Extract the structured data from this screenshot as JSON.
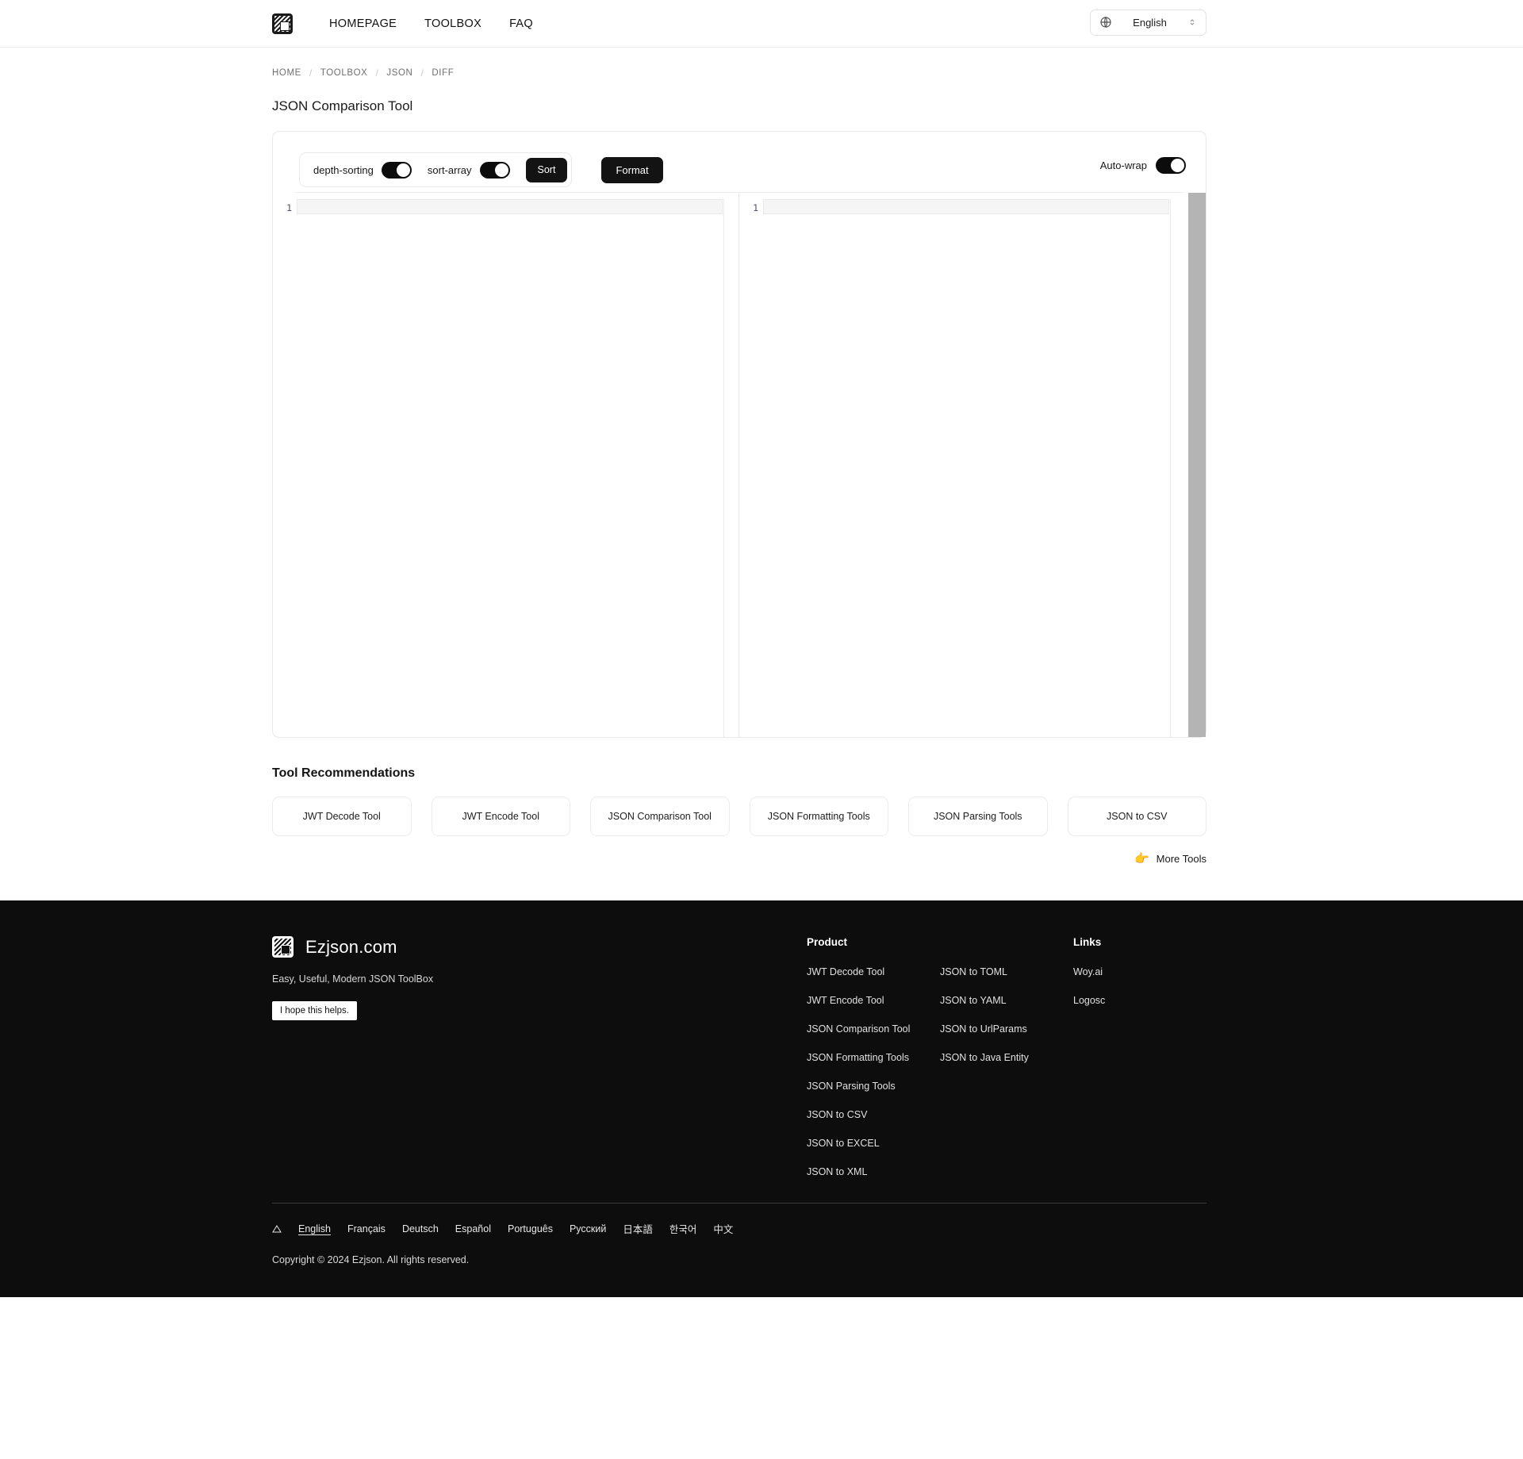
{
  "header": {
    "logo_alt": "Ezjson logo",
    "nav": [
      {
        "label": "HOMEPAGE"
      },
      {
        "label": "TOOLBOX"
      },
      {
        "label": "FAQ"
      }
    ],
    "language_selector": {
      "value": "English",
      "icon": "globe-icon",
      "chevron": "chevron-up-down-icon"
    }
  },
  "breadcrumb": {
    "items": [
      {
        "label": "HOME"
      },
      {
        "label": "TOOLBOX"
      },
      {
        "label": "JSON"
      },
      {
        "label": "DIFF"
      }
    ],
    "separator": "/"
  },
  "page": {
    "title": "JSON Comparison Tool"
  },
  "toolbar": {
    "depth_sorting_label": "depth-sorting",
    "depth_sorting_on": true,
    "sort_array_label": "sort-array",
    "sort_array_on": true,
    "sort_button": "Sort",
    "format_button": "Format",
    "auto_wrap_label": "Auto-wrap",
    "auto_wrap_on": true
  },
  "editor": {
    "left": {
      "line_numbers": [
        "1"
      ],
      "content": ""
    },
    "right": {
      "line_numbers": [
        "1"
      ],
      "content": ""
    },
    "scrollbar_color": "#b4b4b4"
  },
  "recommendations": {
    "title": "Tool Recommendations",
    "cards": [
      {
        "label": "JWT Decode Tool"
      },
      {
        "label": "JWT Encode Tool"
      },
      {
        "label": "JSON Comparison Tool"
      },
      {
        "label": "JSON Formatting Tools"
      },
      {
        "label": "JSON Parsing Tools"
      },
      {
        "label": "JSON to CSV"
      }
    ],
    "more_label": "More Tools",
    "more_icon": "pointing-hand-icon"
  },
  "footer": {
    "brand_name": "Ezjson.com",
    "tagline": "Easy, Useful, Modern JSON ToolBox",
    "chip": "I hope this helps.",
    "product_heading": "Product",
    "product_links_col1": [
      {
        "label": "JWT Decode Tool"
      },
      {
        "label": "JWT Encode Tool"
      },
      {
        "label": "JSON Comparison Tool"
      },
      {
        "label": "JSON Formatting Tools"
      },
      {
        "label": "JSON Parsing Tools"
      },
      {
        "label": "JSON to CSV"
      },
      {
        "label": "JSON to EXCEL"
      },
      {
        "label": "JSON to XML"
      }
    ],
    "product_links_col2": [
      {
        "label": "JSON to TOML"
      },
      {
        "label": "JSON to YAML"
      },
      {
        "label": "JSON to UrlParams"
      },
      {
        "label": "JSON to Java Entity"
      }
    ],
    "links_heading": "Links",
    "links": [
      {
        "label": "Woy.ai"
      },
      {
        "label": "Logosc"
      }
    ],
    "languages": [
      {
        "label": "English",
        "active": true
      },
      {
        "label": "Français",
        "active": false
      },
      {
        "label": "Deutsch",
        "active": false
      },
      {
        "label": "Español",
        "active": false
      },
      {
        "label": "Português",
        "active": false
      },
      {
        "label": "Pусский",
        "active": false
      },
      {
        "label": "日本語",
        "active": false
      },
      {
        "label": "한국어",
        "active": false
      },
      {
        "label": "中文",
        "active": false
      }
    ],
    "copyright": "Copyright © 2024 Ezjson. All rights reserved."
  },
  "colors": {
    "accent_dark": "#131313",
    "footer_bg": "#0d0d0d",
    "border": "#e9e9e9",
    "hand_emoji": "#f5a623"
  }
}
